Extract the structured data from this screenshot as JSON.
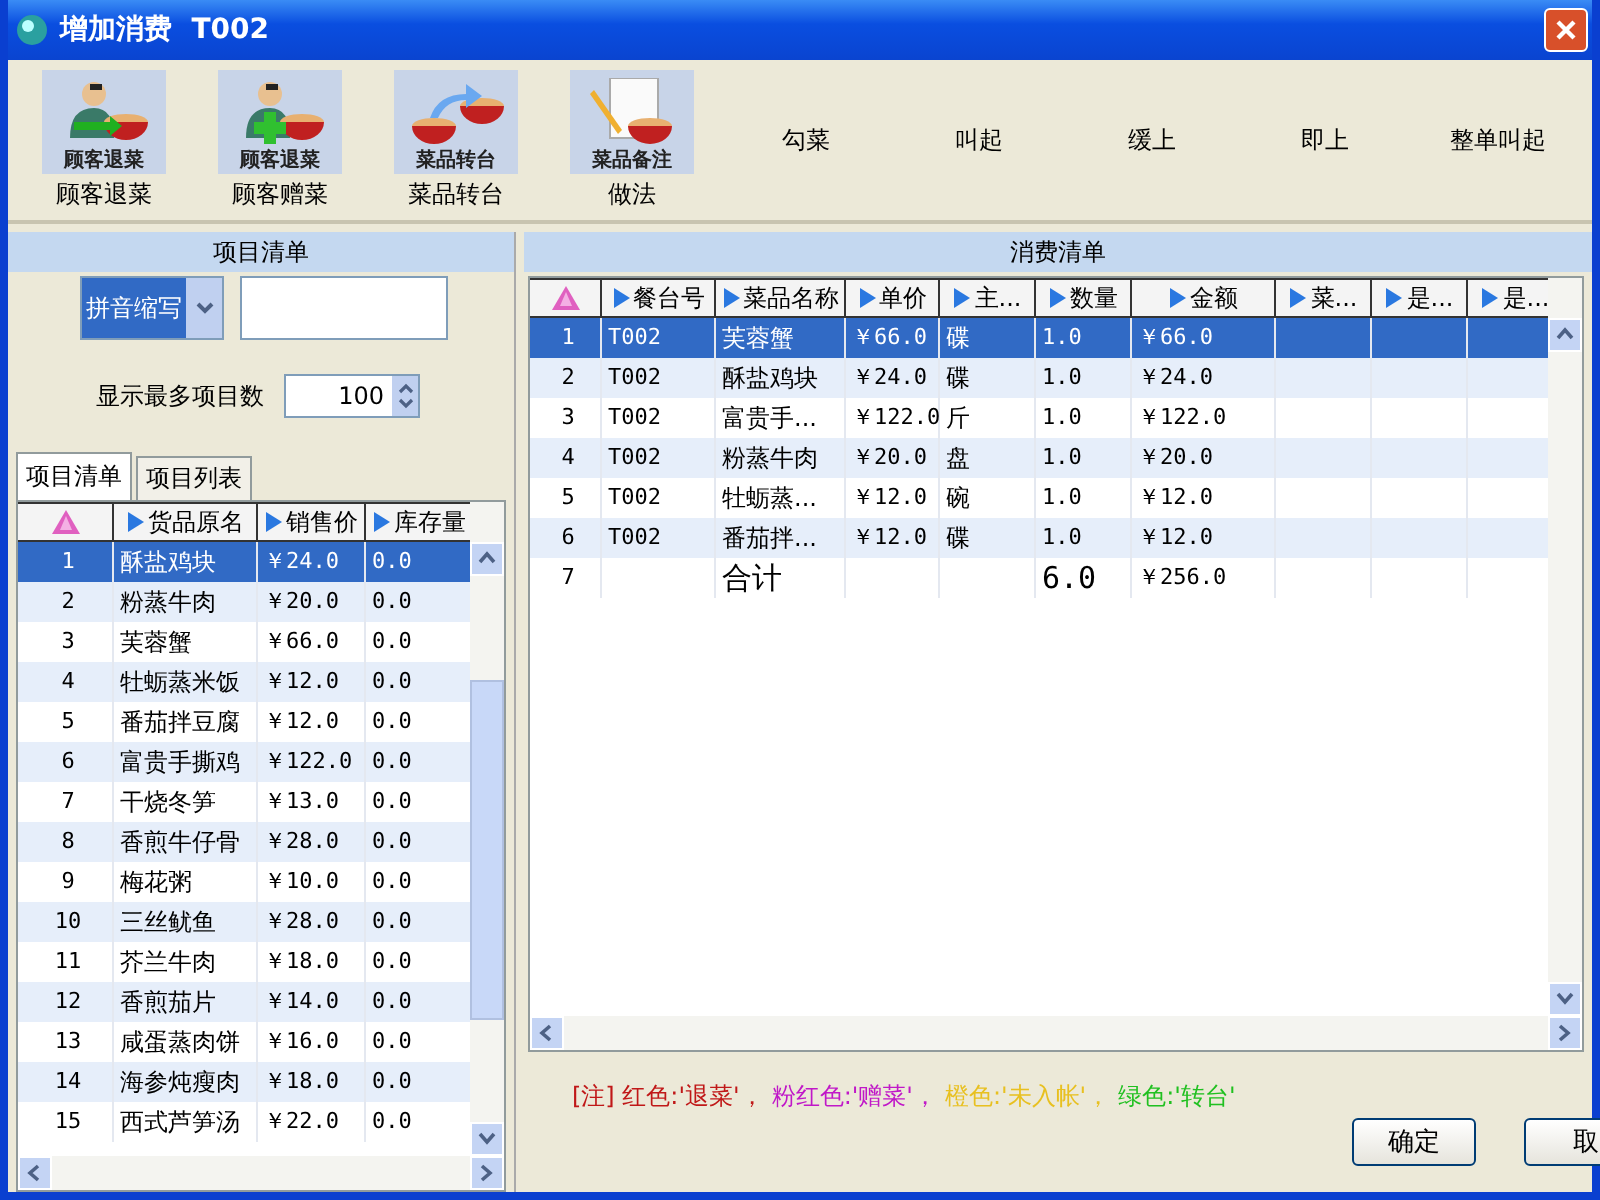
{
  "window": {
    "title": "增加消费  T002"
  },
  "toolbar": {
    "icon_buttons": [
      {
        "kind": "return",
        "caption": "顾客退菜",
        "label": "顾客退菜"
      },
      {
        "kind": "gift",
        "caption": "顾客退菜",
        "label": "顾客赠菜"
      },
      {
        "kind": "transfer",
        "caption": "菜品转台",
        "label": "菜品转台"
      },
      {
        "kind": "note",
        "caption": "菜品备注",
        "label": "做法"
      }
    ],
    "text_buttons": [
      "勾菜",
      "叫起",
      "缓上",
      "即上",
      "整单叫起"
    ]
  },
  "item_panel": {
    "title": "项目清单",
    "search_mode": "拼音缩写",
    "max_items_label": "显示最多项目数",
    "max_items": "100",
    "tabs": [
      {
        "label": "项目清单",
        "selected": true
      },
      {
        "label": "项目列表",
        "selected": false
      }
    ],
    "columns": [
      "货品原名",
      "销售价",
      "库存量"
    ],
    "rows": [
      {
        "no": "1",
        "name": "酥盐鸡块",
        "price": "￥24.0",
        "stock": "0.0",
        "selected": true
      },
      {
        "no": "2",
        "name": "粉蒸牛肉",
        "price": "￥20.0",
        "stock": "0.0",
        "selected": false
      },
      {
        "no": "3",
        "name": "芙蓉蟹",
        "price": "￥66.0",
        "stock": "0.0",
        "selected": false
      },
      {
        "no": "4",
        "name": "牡蛎蒸米饭",
        "price": "￥12.0",
        "stock": "0.0",
        "selected": false
      },
      {
        "no": "5",
        "name": "番茄拌豆腐",
        "price": "￥12.0",
        "stock": "0.0",
        "selected": false
      },
      {
        "no": "6",
        "name": "富贵手撕鸡",
        "price": "￥122.0",
        "stock": "0.0",
        "selected": false
      },
      {
        "no": "7",
        "name": "干烧冬笋",
        "price": "￥13.0",
        "stock": "0.0",
        "selected": false
      },
      {
        "no": "8",
        "name": "香煎牛仔骨",
        "price": "￥28.0",
        "stock": "0.0",
        "selected": false
      },
      {
        "no": "9",
        "name": "梅花粥",
        "price": "￥10.0",
        "stock": "0.0",
        "selected": false
      },
      {
        "no": "10",
        "name": "三丝鱿鱼",
        "price": "￥28.0",
        "stock": "0.0",
        "selected": false
      },
      {
        "no": "11",
        "name": "芥兰牛肉",
        "price": "￥18.0",
        "stock": "0.0",
        "selected": false
      },
      {
        "no": "12",
        "name": "香煎茄片",
        "price": "￥14.0",
        "stock": "0.0",
        "selected": false
      },
      {
        "no": "13",
        "name": "咸蛋蒸肉饼",
        "price": "￥16.0",
        "stock": "0.0",
        "selected": false
      },
      {
        "no": "14",
        "name": "海参炖瘦肉",
        "price": "￥18.0",
        "stock": "0.0",
        "selected": false
      },
      {
        "no": "15",
        "name": "西式芦笋汤",
        "price": "￥22.0",
        "stock": "0.0",
        "selected": false
      }
    ]
  },
  "order_panel": {
    "title": "消费清单",
    "columns": [
      "餐台号",
      "菜品名称",
      "单价",
      "主...",
      "数量",
      "金额",
      "菜...",
      "是...",
      "是..."
    ],
    "rows": [
      {
        "kind": "item",
        "no": "1",
        "table": "T002",
        "name": "芙蓉蟹",
        "price": "￥66.0",
        "unit": "碟",
        "qty": "1.0",
        "amount": "￥66.0",
        "selected": true
      },
      {
        "kind": "item",
        "no": "2",
        "table": "T002",
        "name": "酥盐鸡块",
        "price": "￥24.0",
        "unit": "碟",
        "qty": "1.0",
        "amount": "￥24.0",
        "selected": false
      },
      {
        "kind": "item",
        "no": "3",
        "table": "T002",
        "name": "富贵手...",
        "price": "￥122.0",
        "unit": "斤",
        "qty": "1.0",
        "amount": "￥122.0",
        "selected": false
      },
      {
        "kind": "item",
        "no": "4",
        "table": "T002",
        "name": "粉蒸牛肉",
        "price": "￥20.0",
        "unit": "盘",
        "qty": "1.0",
        "amount": "￥20.0",
        "selected": false
      },
      {
        "kind": "item",
        "no": "5",
        "table": "T002",
        "name": "牡蛎蒸...",
        "price": "￥12.0",
        "unit": "碗",
        "qty": "1.0",
        "amount": "￥12.0",
        "selected": false
      },
      {
        "kind": "item",
        "no": "6",
        "table": "T002",
        "name": "番茄拌...",
        "price": "￥12.0",
        "unit": "碟",
        "qty": "1.0",
        "amount": "￥12.0",
        "selected": false
      },
      {
        "kind": "total",
        "no": "7",
        "name": "合计",
        "qty": "6.0",
        "amount": "￥256.0",
        "selected": false
      }
    ],
    "legend": [
      {
        "text": "[注] 红色:'退菜'，",
        "color": "#c01818"
      },
      {
        "text": "粉红色:'赠菜'，",
        "color": "#c018c8"
      },
      {
        "text": "橙色:'未入帐'，",
        "color": "#e8c020"
      },
      {
        "text": "绿色:'转台'",
        "color": "#20c020"
      }
    ],
    "buttons": [
      "确定",
      "取"
    ]
  }
}
